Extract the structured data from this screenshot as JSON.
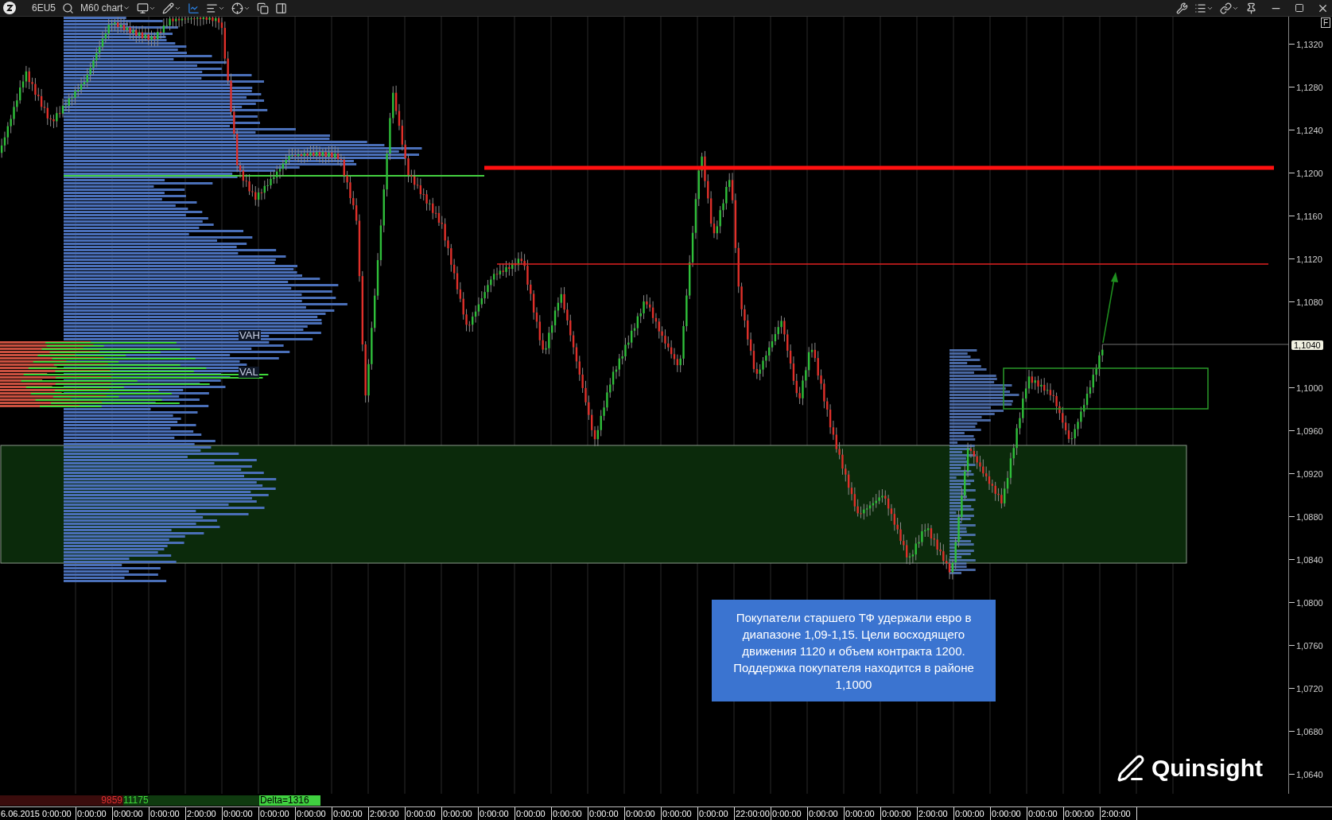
{
  "toolbar": {
    "symbol": "6EU5",
    "chart_name": "M60 chart"
  },
  "price_axis": {
    "corner_button": "F",
    "labels": [
      {
        "text": "1,1320",
        "kind": "tick"
      },
      {
        "text": "1,1280",
        "kind": "tick"
      },
      {
        "text": "1,1240",
        "kind": "tick"
      },
      {
        "text": "1,1200",
        "kind": "tick"
      },
      {
        "text": "1,1160",
        "kind": "tick"
      },
      {
        "text": "1,1120",
        "kind": "tick"
      },
      {
        "text": "1,1080",
        "kind": "tick"
      },
      {
        "text": "1,1040",
        "kind": "current"
      },
      {
        "text": "1,1000",
        "kind": "tick"
      },
      {
        "text": "1,0960",
        "kind": "tick"
      },
      {
        "text": "1,0920",
        "kind": "tick"
      },
      {
        "text": "1,0880",
        "kind": "tick"
      },
      {
        "text": "1,0840",
        "kind": "tick"
      },
      {
        "text": "1,0800",
        "kind": "tick"
      },
      {
        "text": "1,0760",
        "kind": "tick"
      },
      {
        "text": "1,0720",
        "kind": "tick"
      },
      {
        "text": "1,0680",
        "kind": "tick"
      },
      {
        "text": "1,0640",
        "kind": "tick"
      }
    ]
  },
  "chart": {
    "profile_labels": [
      "VAH",
      "VAL"
    ],
    "annotation": "Покупатели старшего ТФ удержали евро в диапазоне 1,09-1,15. Цели восходящего движения 1120 и объем контракта 1200. Поддержка покупателя находится в районе 1,1000",
    "watermark": "Quinsight"
  },
  "delta_bar": {
    "sell": "9859",
    "buy": "11175",
    "delta": "Delta=1316"
  },
  "time_axis": [
    "6.06.2015 0:00:00",
    "0:00:00",
    "0:00:00",
    "0:00:00",
    "2:00:00",
    "0:00:00",
    "0:00:00",
    "0:00:00",
    "0:00:00",
    "2:00:00",
    "0:00:00",
    "0:00:00",
    "0:00:00",
    "0:00:00",
    "0:00:00",
    "0:00:00",
    "0:00:00",
    "0:00:00",
    "0:00:00",
    "22:00:00",
    "0:00:00",
    "0:00:00",
    "0:00:00",
    "0:00:00",
    "2:00:00",
    "0:00:00",
    "0:00:00",
    "0:00:00",
    "0:00:00",
    "2:00:00"
  ]
}
